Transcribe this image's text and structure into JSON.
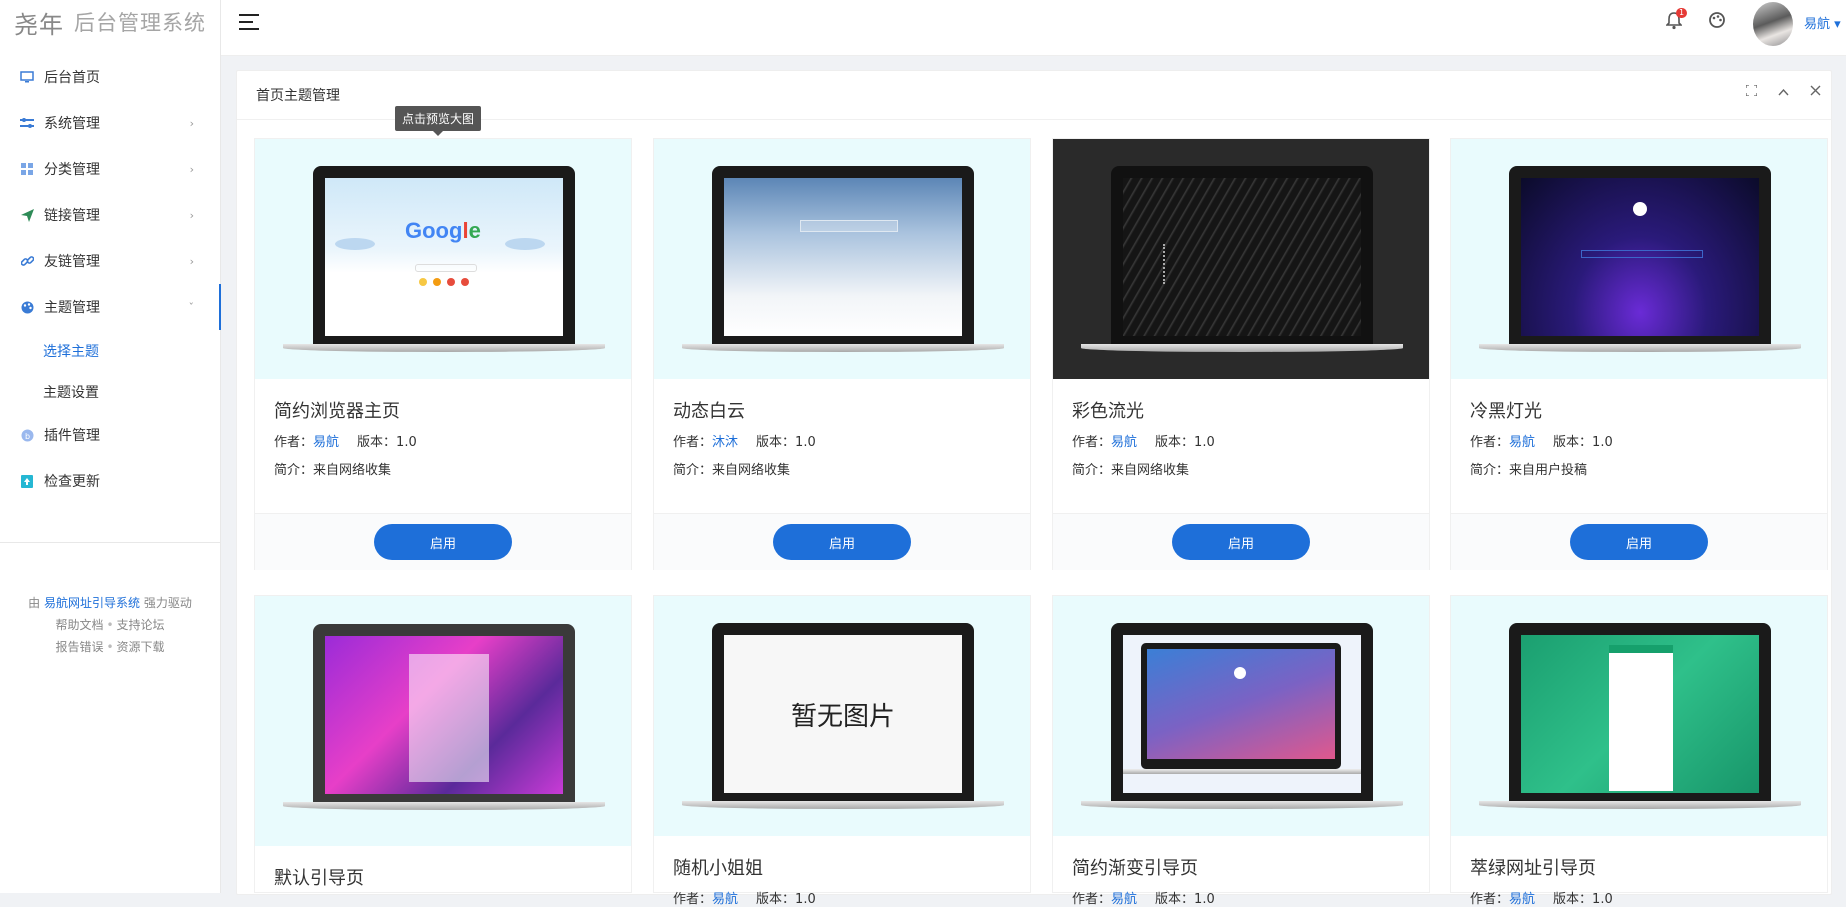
{
  "app": {
    "logo_mark": "尧年",
    "logo_text": "后台管理系统"
  },
  "sidebar": {
    "items": [
      {
        "label": "后台首页",
        "icon": "monitor-icon"
      },
      {
        "label": "系统管理",
        "icon": "sliders-icon",
        "arrow": "›"
      },
      {
        "label": "分类管理",
        "icon": "grid-icon",
        "arrow": "›"
      },
      {
        "label": "链接管理",
        "icon": "send-icon",
        "arrow": "›"
      },
      {
        "label": "友链管理",
        "icon": "link-icon",
        "arrow": "›"
      },
      {
        "label": "主题管理",
        "icon": "palette-icon",
        "arrow": "ˇ"
      },
      {
        "label": "插件管理",
        "icon": "plugin-icon"
      },
      {
        "label": "检查更新",
        "icon": "update-icon"
      }
    ],
    "submenu": [
      {
        "label": "选择主题",
        "active": true
      },
      {
        "label": "主题设置",
        "active": false
      }
    ]
  },
  "footer": {
    "prefix": "由",
    "powered_link": "易航网址引导系统",
    "powered_suffix": "强力驱动",
    "links": [
      "帮助文档",
      "支持论坛",
      "报告错误",
      "资源下载"
    ],
    "separator": "•"
  },
  "topbar": {
    "user_name": "易航",
    "user_caret": "▾",
    "notification_count": "1"
  },
  "panel": {
    "title": "首页主题管理"
  },
  "tooltip": "点击预览大图",
  "labels": {
    "author": "作者：",
    "version": "版本：",
    "desc": "简介：",
    "enable": "启用",
    "no_image": "暂无图片"
  },
  "themes": [
    {
      "title": "简约浏览器主页",
      "author": "易航",
      "version": "1.0",
      "desc": "来自网络收集"
    },
    {
      "title": "动态白云",
      "author": "沐沐",
      "version": "1.0",
      "desc": "来自网络收集"
    },
    {
      "title": "彩色流光",
      "author": "易航",
      "version": "1.0",
      "desc": "来自网络收集"
    },
    {
      "title": "冷黑灯光",
      "author": "易航",
      "version": "1.0",
      "desc": "来自用户投稿"
    },
    {
      "title": "默认引导页"
    },
    {
      "title": "随机小姐姐",
      "author": "易航",
      "version": "1.0"
    },
    {
      "title": "简约渐变引导页",
      "author": "易航",
      "version": "1.0"
    },
    {
      "title": "萃绿网址引导页",
      "author": "易航",
      "version": "1.0"
    }
  ]
}
